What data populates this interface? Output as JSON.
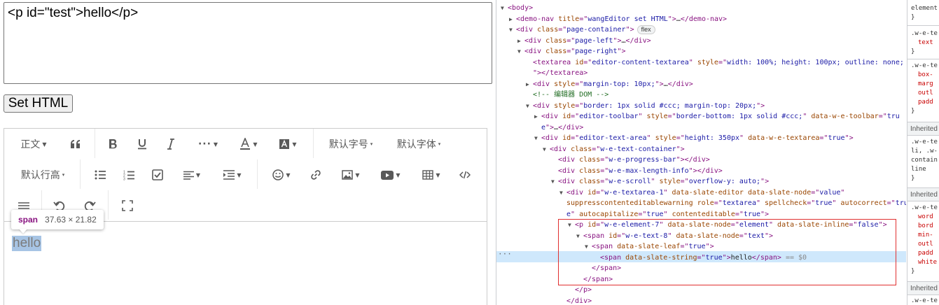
{
  "left": {
    "textarea_value": "<p id=\"test\">hello</p>",
    "set_html_label": "Set HTML",
    "toolbar": {
      "heading": "正文",
      "font_size": "默认字号",
      "font_family": "默认字体",
      "line_height": "默认行高"
    },
    "editor_text": "hello",
    "tooltip": {
      "tag": "span",
      "dims": "37.63 × 21.82"
    }
  },
  "elements": [
    {
      "indent": 0,
      "tri": "▼",
      "html": [
        [
          "t",
          "<body>"
        ]
      ]
    },
    {
      "indent": 1,
      "tri": "▶",
      "html": [
        [
          "t",
          "<demo-nav "
        ],
        [
          "a",
          "title"
        ],
        [
          "t",
          "=\""
        ],
        [
          "v",
          "wangEditor set HTML"
        ],
        [
          "t",
          "\">"
        ],
        [
          "tx",
          "…"
        ],
        [
          "t",
          "</demo-nav>"
        ]
      ]
    },
    {
      "indent": 1,
      "tri": "▼",
      "html": [
        [
          "t",
          "<div "
        ],
        [
          "a",
          "class"
        ],
        [
          "t",
          "=\""
        ],
        [
          "v",
          "page-container"
        ],
        [
          "t",
          "\">"
        ]
      ],
      "badge": "flex"
    },
    {
      "indent": 2,
      "tri": "▶",
      "html": [
        [
          "t",
          "<div "
        ],
        [
          "a",
          "class"
        ],
        [
          "t",
          "=\""
        ],
        [
          "v",
          "page-left"
        ],
        [
          "t",
          "\">"
        ],
        [
          "tx",
          "…"
        ],
        [
          "t",
          "</div>"
        ]
      ]
    },
    {
      "indent": 2,
      "tri": "▼",
      "html": [
        [
          "t",
          "<div "
        ],
        [
          "a",
          "class"
        ],
        [
          "t",
          "=\""
        ],
        [
          "v",
          "page-right"
        ],
        [
          "t",
          "\">"
        ]
      ]
    },
    {
      "indent": 3,
      "tri": "",
      "html": [
        [
          "t",
          "<textarea "
        ],
        [
          "a",
          "id"
        ],
        [
          "t",
          "=\""
        ],
        [
          "v",
          "editor-content-textarea"
        ],
        [
          "t",
          "\" "
        ],
        [
          "a",
          "style"
        ],
        [
          "t",
          "=\""
        ],
        [
          "v",
          "width: 100%; height: 100px; outline: none;"
        ]
      ]
    },
    {
      "indent": 3,
      "tri": "",
      "html": [
        [
          "t",
          "\"></textarea>"
        ]
      ]
    },
    {
      "indent": 3,
      "tri": "▶",
      "html": [
        [
          "t",
          "<div "
        ],
        [
          "a",
          "style"
        ],
        [
          "t",
          "=\""
        ],
        [
          "v",
          "margin-top: 10px;"
        ],
        [
          "t",
          "\">"
        ],
        [
          "tx",
          "…"
        ],
        [
          "t",
          "</div>"
        ]
      ]
    },
    {
      "indent": 3,
      "tri": "",
      "html": [
        [
          "c",
          "<!-- 编辑器 DOM -->"
        ]
      ]
    },
    {
      "indent": 3,
      "tri": "▼",
      "html": [
        [
          "t",
          "<div "
        ],
        [
          "a",
          "style"
        ],
        [
          "t",
          "=\""
        ],
        [
          "v",
          "border: 1px solid #ccc; margin-top: 20px;"
        ],
        [
          "t",
          "\">"
        ]
      ]
    },
    {
      "indent": 4,
      "tri": "▶",
      "html": [
        [
          "t",
          "<div "
        ],
        [
          "a",
          "id"
        ],
        [
          "t",
          "=\""
        ],
        [
          "v",
          "editor-toolbar"
        ],
        [
          "t",
          "\" "
        ],
        [
          "a",
          "style"
        ],
        [
          "t",
          "=\""
        ],
        [
          "v",
          "border-bottom: 1px solid #ccc;"
        ],
        [
          "t",
          "\" "
        ],
        [
          "a",
          "data-w-e-toolbar"
        ],
        [
          "t",
          "=\""
        ],
        [
          "v",
          "tru"
        ]
      ]
    },
    {
      "indent": 4,
      "tri": "",
      "html": [
        [
          "v",
          "e"
        ],
        [
          "t",
          "\">"
        ],
        [
          "tx",
          "…"
        ],
        [
          "t",
          "</div>"
        ]
      ]
    },
    {
      "indent": 4,
      "tri": "▼",
      "html": [
        [
          "t",
          "<div "
        ],
        [
          "a",
          "id"
        ],
        [
          "t",
          "=\""
        ],
        [
          "v",
          "editor-text-area"
        ],
        [
          "t",
          "\" "
        ],
        [
          "a",
          "style"
        ],
        [
          "t",
          "=\""
        ],
        [
          "v",
          "height: 350px"
        ],
        [
          "t",
          "\" "
        ],
        [
          "a",
          "data-w-e-textarea"
        ],
        [
          "t",
          "=\""
        ],
        [
          "v",
          "true"
        ],
        [
          "t",
          "\">"
        ]
      ]
    },
    {
      "indent": 5,
      "tri": "▼",
      "html": [
        [
          "t",
          "<div "
        ],
        [
          "a",
          "class"
        ],
        [
          "t",
          "=\""
        ],
        [
          "v",
          "w-e-text-container"
        ],
        [
          "t",
          "\">"
        ]
      ]
    },
    {
      "indent": 6,
      "tri": "",
      "html": [
        [
          "t",
          "<div "
        ],
        [
          "a",
          "class"
        ],
        [
          "t",
          "=\""
        ],
        [
          "v",
          "w-e-progress-bar"
        ],
        [
          "t",
          "\"></div>"
        ]
      ]
    },
    {
      "indent": 6,
      "tri": "",
      "html": [
        [
          "t",
          "<div "
        ],
        [
          "a",
          "class"
        ],
        [
          "t",
          "=\""
        ],
        [
          "v",
          "w-e-max-length-info"
        ],
        [
          "t",
          "\"></div>"
        ]
      ]
    },
    {
      "indent": 6,
      "tri": "▼",
      "html": [
        [
          "t",
          "<div "
        ],
        [
          "a",
          "class"
        ],
        [
          "t",
          "=\""
        ],
        [
          "v",
          "w-e-scroll"
        ],
        [
          "t",
          "\" "
        ],
        [
          "a",
          "style"
        ],
        [
          "t",
          "=\""
        ],
        [
          "v",
          "overflow-y: auto;"
        ],
        [
          "t",
          "\">"
        ]
      ]
    },
    {
      "indent": 7,
      "tri": "▼",
      "html": [
        [
          "t",
          "<div "
        ],
        [
          "a",
          "id"
        ],
        [
          "t",
          "=\""
        ],
        [
          "v",
          "w-e-textarea-1"
        ],
        [
          "t",
          "\" "
        ],
        [
          "a",
          "data-slate-editor"
        ],
        [
          "t",
          " "
        ],
        [
          "a",
          "data-slate-node"
        ],
        [
          "t",
          "=\""
        ],
        [
          "v",
          "value"
        ],
        [
          "t",
          "\""
        ]
      ]
    },
    {
      "indent": 7,
      "tri": "",
      "html": [
        [
          "a",
          "suppresscontenteditablewarning"
        ],
        [
          "t",
          " "
        ],
        [
          "a",
          "role"
        ],
        [
          "t",
          "=\""
        ],
        [
          "v",
          "textarea"
        ],
        [
          "t",
          "\" "
        ],
        [
          "a",
          "spellcheck"
        ],
        [
          "t",
          "=\""
        ],
        [
          "v",
          "true"
        ],
        [
          "t",
          "\" "
        ],
        [
          "a",
          "autocorrect"
        ],
        [
          "t",
          "=\""
        ],
        [
          "v",
          "tru"
        ]
      ]
    },
    {
      "indent": 7,
      "tri": "",
      "html": [
        [
          "v",
          "e"
        ],
        [
          "t",
          "\" "
        ],
        [
          "a",
          "autocapitalize"
        ],
        [
          "t",
          "=\""
        ],
        [
          "v",
          "true"
        ],
        [
          "t",
          "\" "
        ],
        [
          "a",
          "contenteditable"
        ],
        [
          "t",
          "=\""
        ],
        [
          "v",
          "true"
        ],
        [
          "t",
          "\">"
        ]
      ]
    },
    {
      "indent": 8,
      "tri": "▼",
      "html": [
        [
          "t",
          "<p "
        ],
        [
          "a",
          "id"
        ],
        [
          "t",
          "=\""
        ],
        [
          "v",
          "w-e-element-7"
        ],
        [
          "t",
          "\" "
        ],
        [
          "a",
          "data-slate-node"
        ],
        [
          "t",
          "=\""
        ],
        [
          "v",
          "element"
        ],
        [
          "t",
          "\" "
        ],
        [
          "a",
          "data-slate-inline"
        ],
        [
          "t",
          "=\""
        ],
        [
          "v",
          "false"
        ],
        [
          "t",
          "\">"
        ]
      ]
    },
    {
      "indent": 9,
      "tri": "▼",
      "html": [
        [
          "t",
          "<span "
        ],
        [
          "a",
          "id"
        ],
        [
          "t",
          "=\""
        ],
        [
          "v",
          "w-e-text-8"
        ],
        [
          "t",
          "\" "
        ],
        [
          "a",
          "data-slate-node"
        ],
        [
          "t",
          "=\""
        ],
        [
          "v",
          "text"
        ],
        [
          "t",
          "\">"
        ]
      ]
    },
    {
      "indent": 10,
      "tri": "▼",
      "html": [
        [
          "t",
          "<span "
        ],
        [
          "a",
          "data-slate-leaf"
        ],
        [
          "t",
          "=\""
        ],
        [
          "v",
          "true"
        ],
        [
          "t",
          "\">"
        ]
      ]
    },
    {
      "indent": 11,
      "tri": "",
      "html": [
        [
          "t",
          "<span "
        ],
        [
          "a",
          "data-slate-string"
        ],
        [
          "t",
          "=\""
        ],
        [
          "v",
          "true"
        ],
        [
          "t",
          "\">"
        ],
        [
          "tx",
          "hello"
        ],
        [
          "t",
          "</span>"
        ],
        [
          "eq",
          " == $0"
        ]
      ]
    },
    {
      "indent": 10,
      "tri": "",
      "html": [
        [
          "t",
          "</span>"
        ]
      ]
    },
    {
      "indent": 9,
      "tri": "",
      "html": [
        [
          "t",
          "</span>"
        ]
      ]
    },
    {
      "indent": 8,
      "tri": "",
      "html": [
        [
          "t",
          "</p>"
        ]
      ]
    },
    {
      "indent": 7,
      "tri": "",
      "html": [
        [
          "t",
          "</div>"
        ]
      ]
    }
  ],
  "styles": {
    "lines": [
      "element",
      "}",
      ".w-e-te",
      "text",
      "}",
      ".w-e-te",
      "box-",
      "marg",
      "outl",
      "padd",
      "}"
    ],
    "inherited1": "Inherited",
    "lines2": [
      ".w-e-te",
      "li, .w-",
      "contain",
      "line",
      "}"
    ],
    "inherited2": "Inherited",
    "lines3": [
      ".w-e-te",
      "word",
      "bord",
      "min-",
      "outl",
      "padd",
      "white",
      "}"
    ],
    "inherited3": "Inherited",
    "lines4": [
      ".w-e-te"
    ]
  }
}
